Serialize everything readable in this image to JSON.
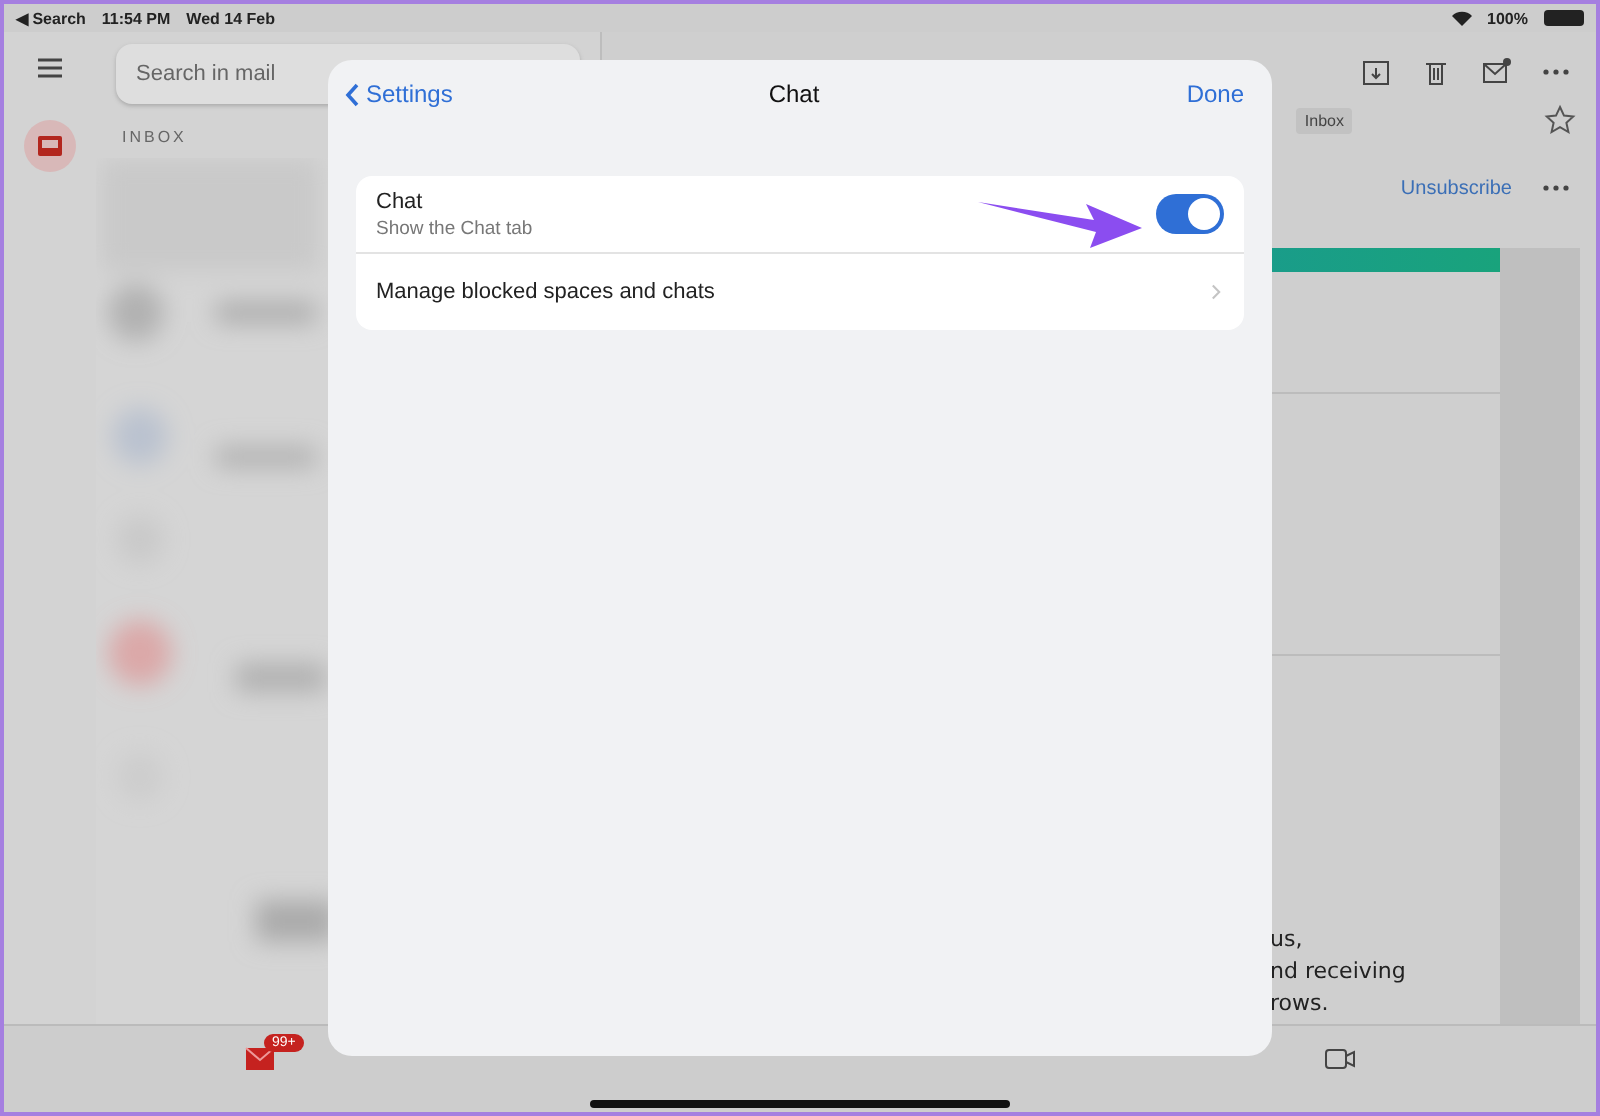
{
  "status_bar": {
    "back": "◀ Search",
    "time": "11:54 PM",
    "date": "Wed 14 Feb",
    "battery": "100%"
  },
  "mail": {
    "search": {
      "placeholder": "Search in mail"
    },
    "folder": "INBOX",
    "label_tag": "Inbox",
    "action": "Unsubscribe",
    "body_lines": [
      "us,",
      "nd receiving",
      "rows."
    ]
  },
  "tab_bar": {
    "badge": "99+"
  },
  "dialog": {
    "back": "Settings",
    "title": "Chat",
    "done": "Done",
    "rows": [
      {
        "kind": "toggle",
        "title": "Chat",
        "subtitle": "Show the Chat tab",
        "on": true
      },
      {
        "kind": "link",
        "title": "Manage blocked spaces and chats"
      }
    ]
  }
}
